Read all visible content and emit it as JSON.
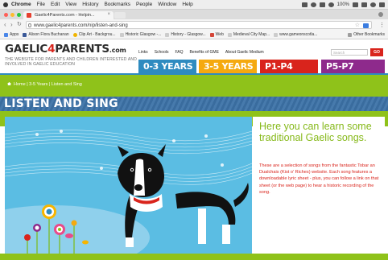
{
  "os_menu": {
    "app": "Chrome",
    "items": [
      "File",
      "Edit",
      "View",
      "History",
      "Bookmarks",
      "People",
      "Window",
      "Help"
    ],
    "battery": "100%"
  },
  "browser": {
    "tab_title": "Gaelic4Parents.com - Helpin...",
    "url": "www.gaelic4parents.com/nip/listen-and-sing",
    "bookmarks": [
      "Apps",
      "Alison Flora Buchanan",
      "Clip Art - Backgrou...",
      "Historic Glasgow -...",
      "History - Glasgow...",
      "Web",
      "Medieval City Map...",
      "www.gameonscotla..."
    ],
    "other_bookmarks": "Other Bookmarks"
  },
  "site": {
    "logo_main": "GAELIC",
    "logo_four": "4",
    "logo_end": "PARENTS",
    "logo_tld": ".com",
    "tagline": "THE WEBSITE FOR PARENTS AND CHILDREN INTERESTED AND INVOLVED IN GAELIC EDUCATION",
    "nav": [
      "Links",
      "Schools",
      "FAQ",
      "Benefits of GME",
      "About Gaelic Medium"
    ],
    "search_placeholder": "Search",
    "go_label": "GO",
    "age_tabs": [
      {
        "label": "0-3 YEARS",
        "color": "#2e8bc0"
      },
      {
        "label": "3-5 YEARS",
        "color": "#f5a90f"
      },
      {
        "label": "P1-P4",
        "color": "#d9241c"
      },
      {
        "label": "P5-P7",
        "color": "#8e2a8c"
      }
    ],
    "breadcrumb": {
      "home": "Home",
      "sep": "|",
      "level": "3-5 Years",
      "page": "Listen and Sing"
    },
    "page_title": "LISTEN AND SING",
    "intro": "Here you can learn some traditional Gaelic songs.",
    "body": "These are a selection of songs from the fantastic Tobar an Dualchais (Kist o' Riches) website. Each song features a downloadable lyric sheet - plus, you can follow a link on that sheet (or the web page) to hear a historic recording of the song."
  }
}
